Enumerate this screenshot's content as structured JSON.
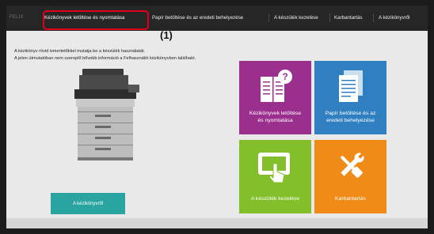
{
  "nav": {
    "brand": "FELIX",
    "items": [
      {
        "label": "Kézikönyvek letöltése és nyomtatása"
      },
      {
        "label": "Papír betöltése és az eredeti behelyezése"
      },
      {
        "label": "A készülék kezelése"
      },
      {
        "label": "Karbantartás"
      },
      {
        "label": "A kézikönyvről"
      }
    ]
  },
  "callout": "(1)",
  "intro": {
    "line1": "A kézikönyv rövid ismertetőkkel mutatja be a készülék használatát.",
    "line2": "A jelen útmutatóban nem szereplő bővebb információ a Felhasználói kézikönyvben található."
  },
  "about_button": "A kézikönyvről",
  "tiles": [
    {
      "line1": "Kézikönyvek letöltése",
      "line2": "és nyomtatása",
      "icon": "manual-help-icon"
    },
    {
      "line1": "Papír betöltése és az",
      "line2": "eredeti behelyezése",
      "icon": "documents-icon"
    },
    {
      "line1": "A készülék kezelése",
      "line2": "",
      "icon": "touch-panel-icon"
    },
    {
      "line1": "Karbantartás",
      "line2": "",
      "icon": "tools-icon"
    }
  ],
  "colors": {
    "highlight": "#e0001b",
    "tile_purple": "#9b2f8e",
    "tile_blue": "#2f7fc1",
    "tile_green": "#82bf2a",
    "tile_orange": "#f08b18",
    "about_button": "#2aa4a0"
  }
}
